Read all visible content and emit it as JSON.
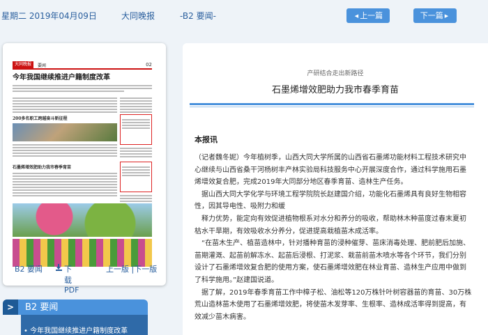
{
  "header": {
    "date": "星期二 2019年04月09日",
    "paper": "大同晚报",
    "page": "-B2 要闻-",
    "prev_label": "上一篇",
    "next_label": "下一篇"
  },
  "thumbnail": {
    "logo": "大同晚报",
    "section": "要闻",
    "page_num": "02",
    "lead_title": "今年我国继续推进户籍制度改革",
    "mid_title": "200多名职工跨越奋斗新征程",
    "side_title": "石墨烯增效肥助力我市春季育苗"
  },
  "thumb_footer": {
    "page": "B2 要闻",
    "pdf": "下载PDF",
    "prevnext": "上一版 |下一版"
  },
  "section_nav": {
    "label": "B2 要闻",
    "first_item": "• 今年我国继续推进户籍制度改革"
  },
  "article": {
    "kicker": "产研结合走出新路径",
    "headline": "石墨烯增效肥助力我市春季育苗",
    "byline": "本报讯",
    "paragraphs": [
      "（记者魏冬妮）今年植树季，山西大同大学所属的山西省石墨烯功能材料工程技术研究中心继续与山西省桑干河杨树丰产林实验局科技服务中心开展深度合作，通过科学施用石墨烯增效复合肥，完成2019年大同部分地区春季育苗、造林生产任务。",
      "　据山西大同大学化学与环境工程学院院长赵建国介绍，功能化石墨烯具有良好生物相容性，因其导电性、吸附力和缓",
      "　释力优势，能定向有效促进植物根系对水分和养分的吸收，帮助林木种苗度过春末夏初枯水干旱期，有效吸收水分养分，促进提高栽植苗木成活率。",
      "　“在苗木生产、植苗造林中，针对播种育苗的浸种催芽、苗床消毒处理、肥前肥后加施、苗期灌溉、起苗前解冻水、起苗后浸根、打泥浆、栽苗前苗木喷水等各个环节，我们分别设计了石墨烯增效复合肥的使用方案，使石墨烯增效肥在林业育苗、造林生产应用中做到了科学施用。”赵建国说道。",
      "　据了解，2019年春季育苗工作中樟子松、油松等120万株针叶树容器苗的育苗、30万株荒山造林苗木使用了石墨烯增效肥，将使苗木发芽率、生根率、造林成活率得到提高，有效减少苗木病害。"
    ]
  }
}
